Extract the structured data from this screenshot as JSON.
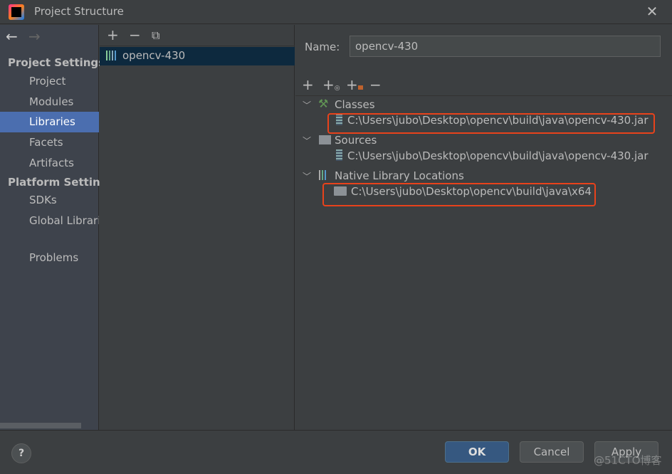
{
  "window": {
    "title": "Project Structure"
  },
  "sidebar": {
    "sections": [
      {
        "title": "Project Settings",
        "items": [
          "Project",
          "Modules",
          "Libraries",
          "Facets",
          "Artifacts"
        ]
      },
      {
        "title": "Platform Settings",
        "items": [
          "SDKs",
          "Global Libraries"
        ]
      }
    ],
    "problems": "Problems",
    "selected": "Libraries"
  },
  "libraries": {
    "items": [
      "opencv-430"
    ]
  },
  "detail": {
    "name_label": "Name:",
    "name_value": "opencv-430",
    "tree": {
      "classes": {
        "label": "Classes",
        "items": [
          "C:\\Users\\jubo\\Desktop\\opencv\\build\\java\\opencv-430.jar"
        ]
      },
      "sources": {
        "label": "Sources",
        "items": [
          "C:\\Users\\jubo\\Desktop\\opencv\\build\\java\\opencv-430.jar"
        ]
      },
      "native": {
        "label": "Native Library Locations",
        "items": [
          "C:\\Users\\jubo\\Desktop\\opencv\\build\\java\\x64"
        ]
      }
    }
  },
  "footer": {
    "help": "?",
    "ok": "OK",
    "cancel": "Cancel",
    "apply": "Apply"
  },
  "watermark": "@51CTO博客",
  "colors": {
    "selection": "#4b6eaf",
    "highlight_box": "#e8421b",
    "ok_button": "#365880"
  }
}
